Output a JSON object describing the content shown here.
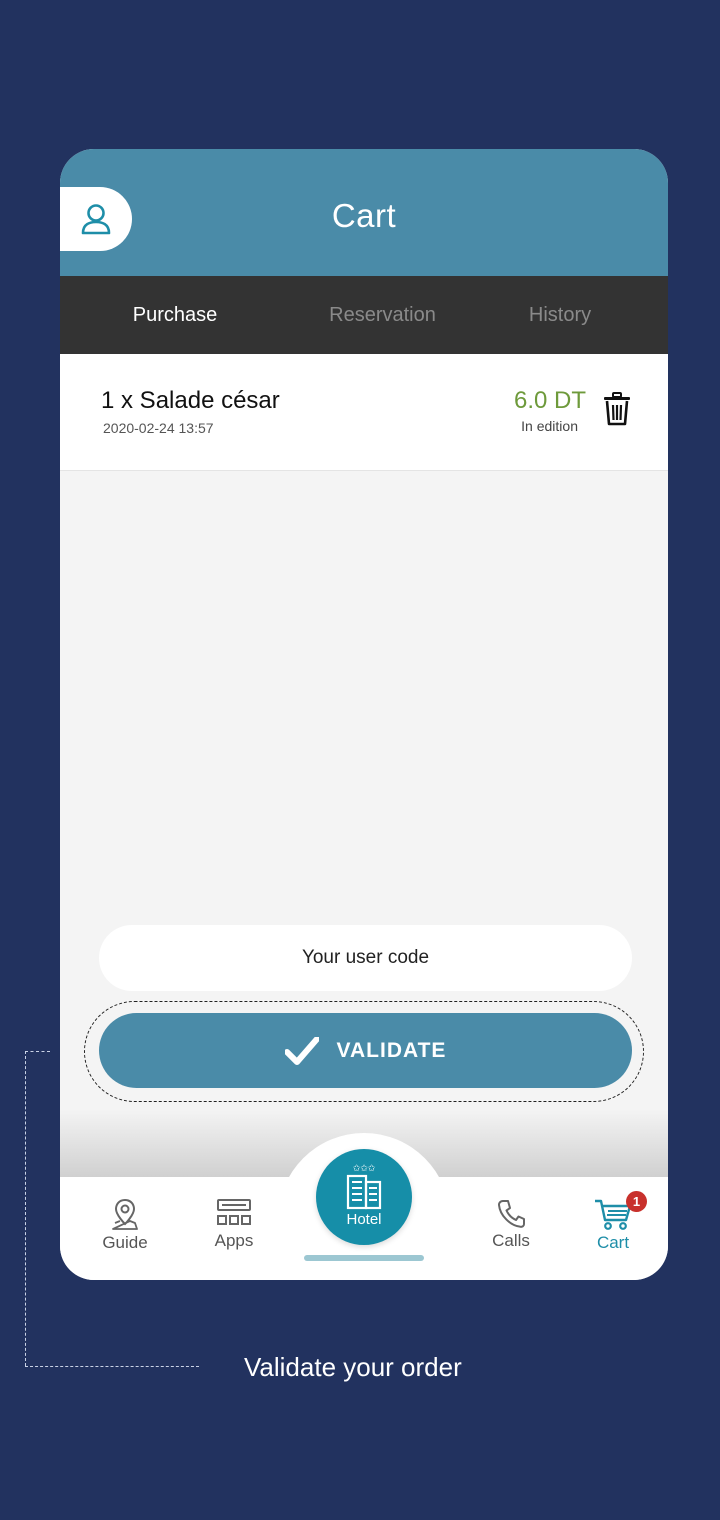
{
  "header": {
    "title": "Cart"
  },
  "tabs": [
    {
      "label": "Purchase",
      "active": true
    },
    {
      "label": "Reservation",
      "active": false
    },
    {
      "label": "History",
      "active": false
    }
  ],
  "cart_items": [
    {
      "name": "1 x Salade césar",
      "date": "2020-02-24 13:57",
      "price": "6.0 DT",
      "status": "In edition"
    }
  ],
  "user_code": {
    "placeholder": "Your user code",
    "value": ""
  },
  "validate_button": {
    "label": "VALIDATE"
  },
  "bottom_nav": {
    "guide": "Guide",
    "apps": "Apps",
    "hotel": "Hotel",
    "calls": "Calls",
    "cart": "Cart",
    "cart_badge": "1"
  },
  "caption": "Validate your order",
  "colors": {
    "background": "#22325f",
    "accent": "#4a8ba8",
    "hotel_button": "#168ea8",
    "price": "#6e9a3b",
    "badge": "#c8312c",
    "tab_bar": "#333333"
  }
}
